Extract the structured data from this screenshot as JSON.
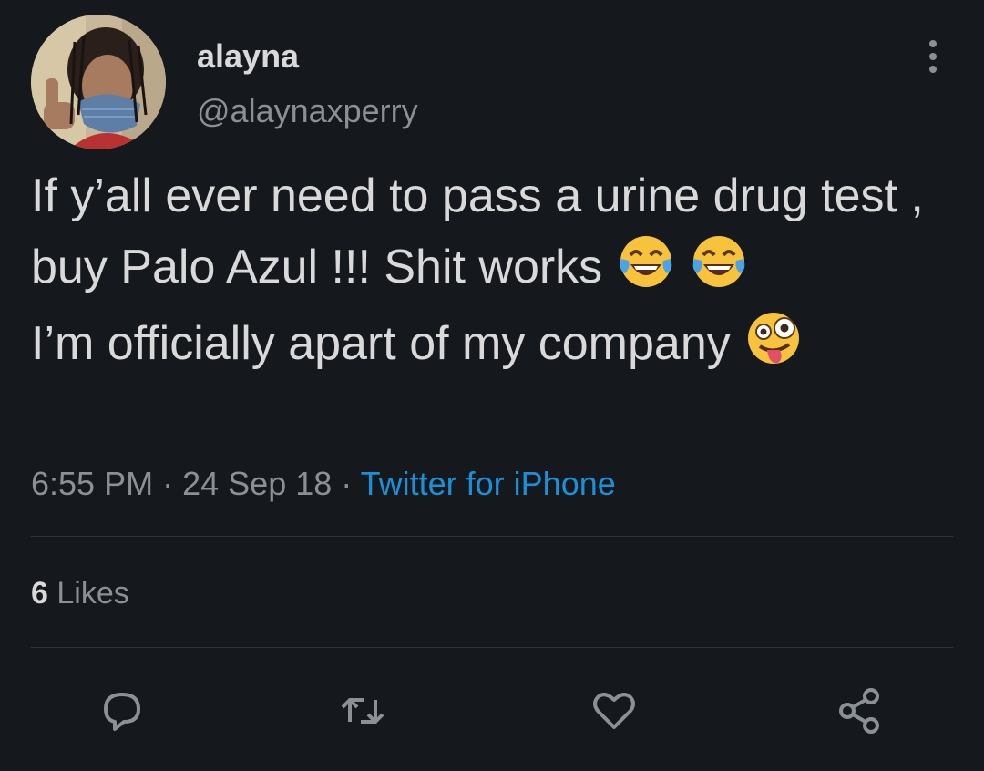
{
  "user": {
    "display_name": "alayna",
    "handle": "@alaynaxperry"
  },
  "tweet": {
    "line1_text": "If y’all ever need to pass a urine drug test , buy Palo Azul !!! Shit works ",
    "line1_emojis": [
      "face-with-tears-of-joy-icon",
      "face-with-tears-of-joy-icon"
    ],
    "line2_text": "I’m officially apart of my company ",
    "line2_emoji": "zany-face-icon"
  },
  "meta": {
    "time": "6:55 PM",
    "separator": "·",
    "date": "24 Sep 18",
    "source": "Twitter for iPhone"
  },
  "stats": {
    "likes_count": "6",
    "likes_label": "Likes"
  },
  "actions": [
    "reply-icon",
    "retweet-icon",
    "like-icon",
    "share-icon"
  ],
  "colors": {
    "background": "#15181c",
    "text": "#d9d9d9",
    "secondary": "#8b9096",
    "link": "#1d8fd6",
    "divider": "#2f3336"
  }
}
